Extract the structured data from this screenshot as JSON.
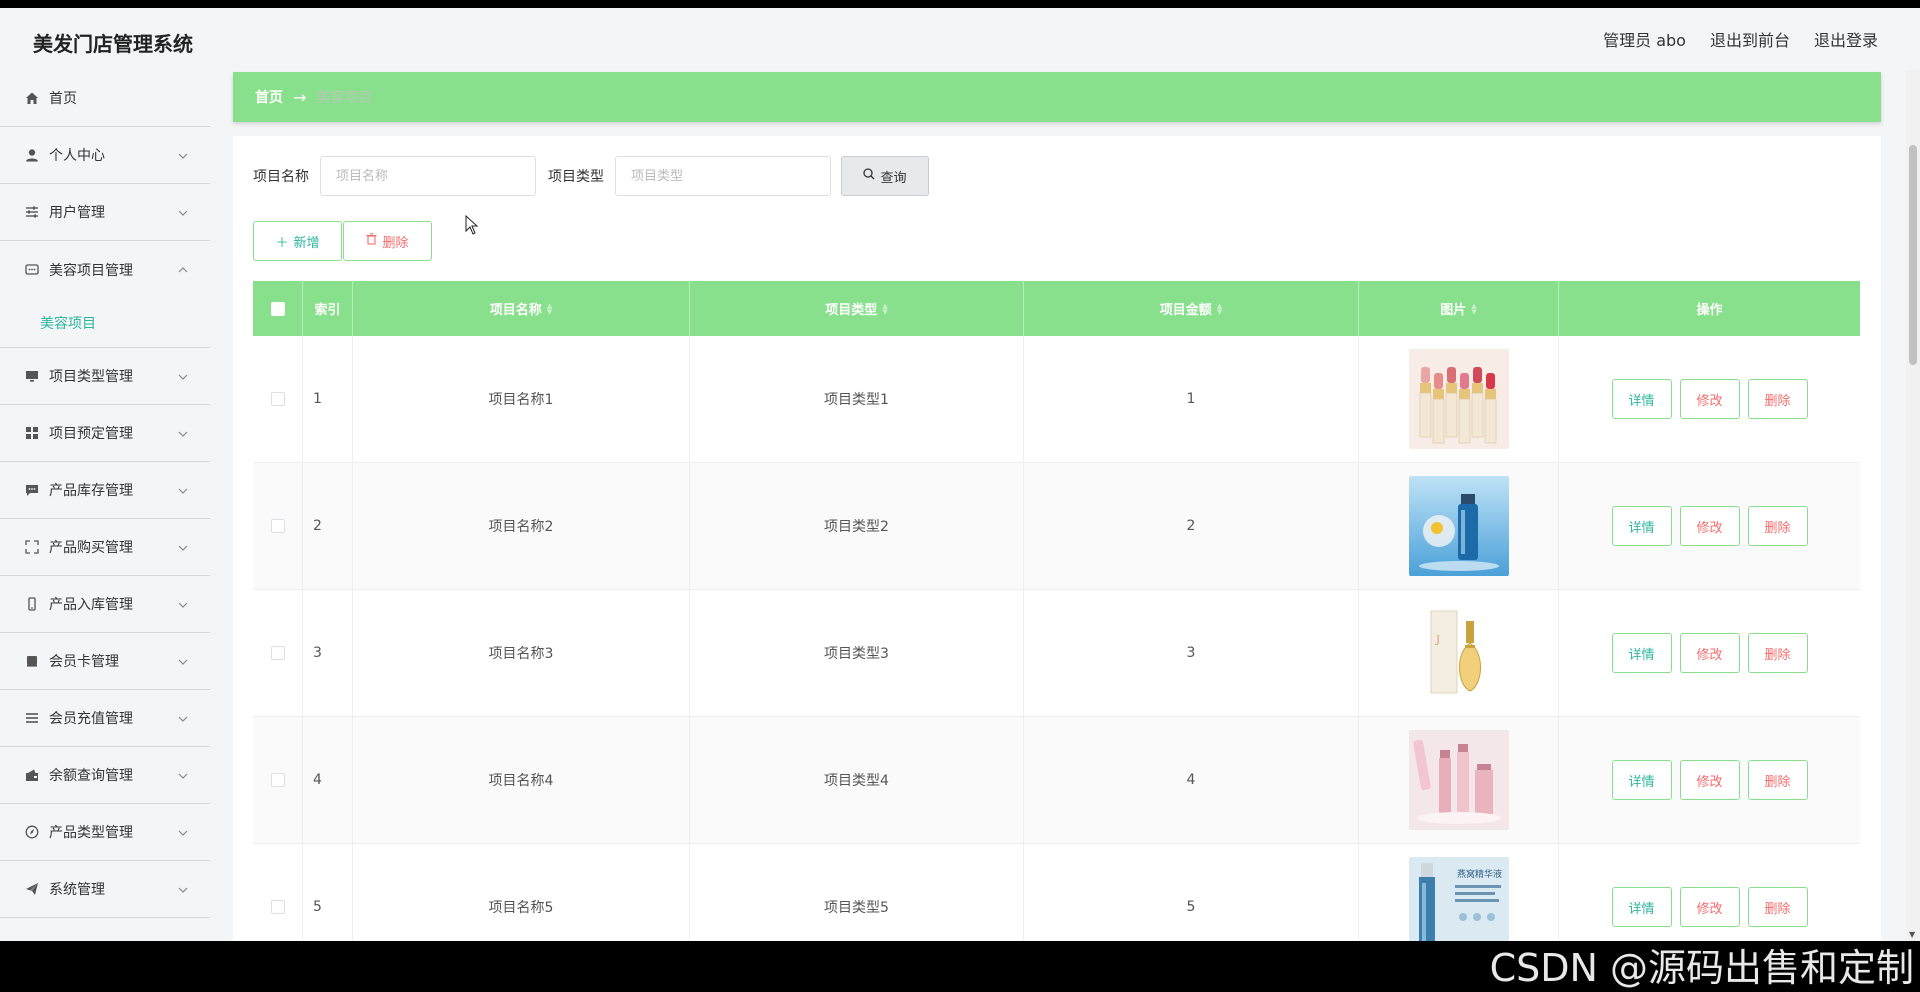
{
  "app": {
    "title": "美发门店管理系统"
  },
  "header": {
    "admin": "管理员 abo",
    "to_front": "退出到前台",
    "logout": "退出登录"
  },
  "sidebar": {
    "items": [
      {
        "label": "首页",
        "icon": "home-icon",
        "expandable": false
      },
      {
        "label": "个人中心",
        "icon": "user-icon",
        "expandable": true
      },
      {
        "label": "用户管理",
        "icon": "sliders-icon",
        "expandable": true
      },
      {
        "label": "美容项目管理",
        "icon": "chat-icon",
        "expandable": true,
        "open": true,
        "sub": [
          "美容项目"
        ]
      },
      {
        "label": "项目类型管理",
        "icon": "monitor-icon",
        "expandable": true
      },
      {
        "label": "项目预定管理",
        "icon": "grid-icon",
        "expandable": true
      },
      {
        "label": "产品库存管理",
        "icon": "message-icon",
        "expandable": true
      },
      {
        "label": "产品购买管理",
        "icon": "fullscreen-icon",
        "expandable": true
      },
      {
        "label": "产品入库管理",
        "icon": "phone-icon",
        "expandable": true
      },
      {
        "label": "会员卡管理",
        "icon": "card-icon",
        "expandable": true
      },
      {
        "label": "会员充值管理",
        "icon": "list-icon",
        "expandable": true
      },
      {
        "label": "余额查询管理",
        "icon": "wallet-icon",
        "expandable": true
      },
      {
        "label": "产品类型管理",
        "icon": "compass-icon",
        "expandable": true
      },
      {
        "label": "系统管理",
        "icon": "send-icon",
        "expandable": true
      }
    ]
  },
  "breadcrumb": {
    "home": "首页",
    "arrow": "→",
    "current": "美容项目"
  },
  "search": {
    "name_label": "项目名称",
    "name_placeholder": "项目名称",
    "name_value": "",
    "type_label": "项目类型",
    "type_placeholder": "项目类型",
    "type_value": "",
    "query_label": "查询"
  },
  "actions": {
    "add_label": "新增",
    "delete_label": "删除"
  },
  "table": {
    "columns": [
      "索引",
      "项目名称",
      "项目类型",
      "项目金额",
      "图片",
      "操作"
    ],
    "rows": [
      {
        "index": "1",
        "name": "项目名称1",
        "type": "项目类型1",
        "amount": "1",
        "image": "lipsticks"
      },
      {
        "index": "2",
        "name": "项目名称2",
        "type": "项目类型2",
        "amount": "2",
        "image": "serum-bottle"
      },
      {
        "index": "3",
        "name": "项目名称3",
        "type": "项目类型3",
        "amount": "3",
        "image": "perfume"
      },
      {
        "index": "4",
        "name": "项目名称4",
        "type": "项目类型4",
        "amount": "4",
        "image": "skincare-set"
      },
      {
        "index": "5",
        "name": "项目名称5",
        "type": "项目类型5",
        "amount": "5",
        "image": "essence-bottle"
      }
    ],
    "row_actions": {
      "detail": "详情",
      "edit": "修改",
      "delete": "删除"
    }
  },
  "watermark": "CSDN @源码出售和定制",
  "colors": {
    "accent_green": "#89e08c",
    "teal_text": "#2cb5a0",
    "danger": "#f56c6c"
  }
}
